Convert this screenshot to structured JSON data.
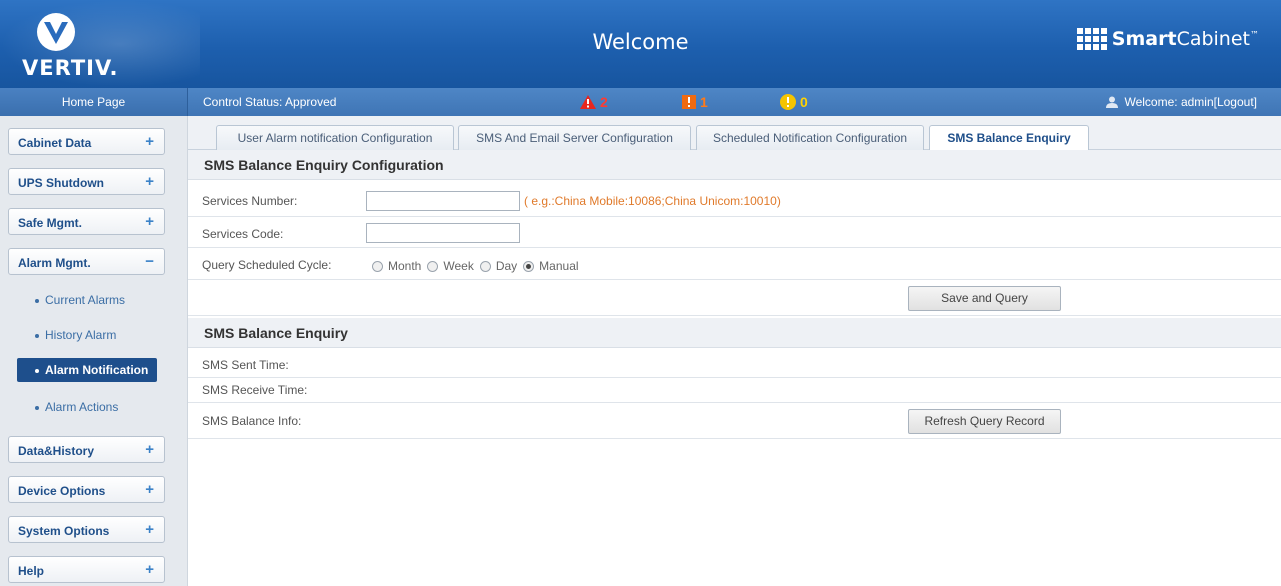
{
  "header": {
    "logo_text": "VERTIV.",
    "title": "Welcome",
    "brand_bold": "Smart",
    "brand_regular": "Cabinet",
    "brand_tm": "™"
  },
  "statusbar": {
    "home": "Home Page",
    "control_status": "Control Status:  Approved",
    "critical_count": "2",
    "major_count": "1",
    "minor_count": "0",
    "welcome": "Welcome: admin[Logout]"
  },
  "sidebar": {
    "menus": [
      {
        "label": "Cabinet Data",
        "sign": "+"
      },
      {
        "label": "UPS Shutdown",
        "sign": "+"
      },
      {
        "label": "Safe Mgmt.",
        "sign": "+"
      },
      {
        "label": "Alarm Mgmt.",
        "sign": "−"
      },
      {
        "label": "Data&History",
        "sign": "+"
      },
      {
        "label": "Device Options",
        "sign": "+"
      },
      {
        "label": "System Options",
        "sign": "+"
      },
      {
        "label": "Help",
        "sign": "+"
      }
    ],
    "alarm_sub": [
      {
        "label": "Current Alarms"
      },
      {
        "label": "History Alarm"
      },
      {
        "label": "Alarm Notification"
      },
      {
        "label": "Alarm Actions"
      }
    ]
  },
  "tabs": [
    {
      "label": "User Alarm notification Configuration"
    },
    {
      "label": "SMS And Email Server Configuration"
    },
    {
      "label": "Scheduled Notification Configuration"
    },
    {
      "label": "SMS Balance Enquiry"
    }
  ],
  "config": {
    "title": "SMS Balance Enquiry Configuration",
    "services_number_label": "Services Number:",
    "services_number_value": "",
    "services_number_hint": "( e.g.:China Mobile:10086;China Unicom:10010)",
    "services_code_label": "Services Code:",
    "services_code_value": "",
    "cycle_label": "Query Scheduled Cycle:",
    "cycle_options": [
      "Month",
      "Week",
      "Day",
      "Manual"
    ],
    "cycle_selected": "Manual",
    "save_button": "Save and Query"
  },
  "enquiry": {
    "title": "SMS Balance Enquiry",
    "sent_time_label": "SMS Sent Time:",
    "receive_time_label": "SMS Receive Time:",
    "balance_info_label": "SMS Balance Info:",
    "refresh_button": "Refresh Query Record"
  },
  "colors": {
    "header_blue": "#1d5fae",
    "status_blue": "#3f75b5",
    "active_nav": "#1e4f8c",
    "hint_orange": "#e07a2b",
    "critical_red": "#ff3b30",
    "major_orange": "#ff7a18",
    "minor_yellow": "#ffd200"
  },
  "icons": [
    "vertiv-logo-icon",
    "smartcabinet-logo-icon",
    "critical-alarm-icon",
    "major-alarm-icon",
    "minor-alarm-icon",
    "user-icon"
  ]
}
